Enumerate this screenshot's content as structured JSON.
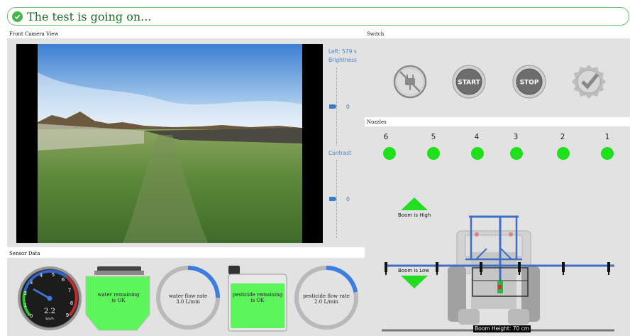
{
  "status": {
    "text": "The test is going on...",
    "color": "#43b649"
  },
  "camera": {
    "title": "Front Camera View",
    "time_left": "Left: 579 s",
    "brightness_label": "Brightness",
    "brightness_value": "0",
    "contrast_label": "Contrast",
    "contrast_value": "0"
  },
  "switch": {
    "title": "Switch",
    "buttons": [
      {
        "name": "power-disabled-icon",
        "label": ""
      },
      {
        "name": "start-button",
        "label": "START"
      },
      {
        "name": "stop-button",
        "label": "STOP"
      },
      {
        "name": "completed-mission-icon",
        "label": "COMPLETED MISSION"
      }
    ]
  },
  "nozzles": {
    "title": "Nozzles",
    "items": [
      {
        "label": "6",
        "state": "on"
      },
      {
        "label": "5",
        "state": "on"
      },
      {
        "label": "4",
        "state": "on"
      },
      {
        "label": "3",
        "state": "on"
      },
      {
        "label": "2",
        "state": "on"
      },
      {
        "label": "1",
        "state": "on"
      }
    ],
    "boom_high": "Boom is High",
    "boom_low": "Boom is Low",
    "boom_height": "Boom Height: 70 cm",
    "active_color": "#1ee11a"
  },
  "sensor": {
    "title": "Sensor Data",
    "speedometer": {
      "value": "2.2",
      "unit": "km/h",
      "ticks": [
        "0",
        "1",
        "2",
        "3",
        "4",
        "5",
        "6",
        "7",
        "8",
        "9"
      ]
    },
    "water_tank": {
      "text_line1": "water remaining",
      "text_line2": "is OK",
      "color": "#5cf55c"
    },
    "water_flow": {
      "label": "water flow rate",
      "value": "3.0  L/min",
      "fraction": 0.25
    },
    "pesticide_tank": {
      "text_line1": "pesticide remaining",
      "text_line2": "is OK",
      "color": "#5cf55c"
    },
    "pesticide_flow": {
      "label": "pesticide flow rate",
      "value": "2.0  L/min",
      "fraction": 0.22
    }
  }
}
